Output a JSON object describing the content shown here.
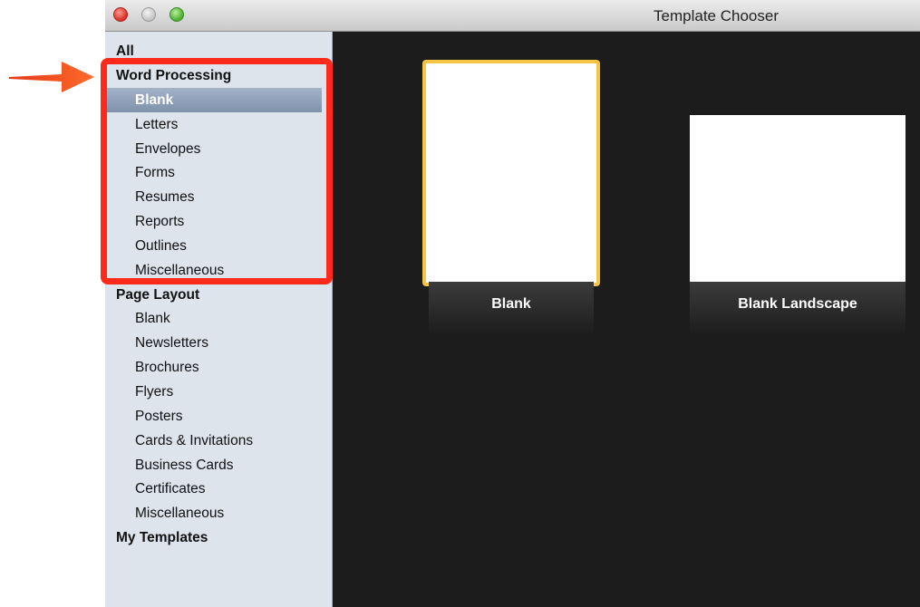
{
  "window": {
    "title": "Template Chooser"
  },
  "sidebar": {
    "all": "All",
    "word_processing": {
      "label": "Word Processing",
      "items": [
        "Blank",
        "Letters",
        "Envelopes",
        "Forms",
        "Resumes",
        "Reports",
        "Outlines",
        "Miscellaneous"
      ]
    },
    "page_layout": {
      "label": "Page Layout",
      "items": [
        "Blank",
        "Newsletters",
        "Brochures",
        "Flyers",
        "Posters",
        "Cards & Invitations",
        "Business Cards",
        "Certificates",
        "Miscellaneous"
      ]
    },
    "my_templates": "My Templates",
    "selected": "Blank"
  },
  "templates": [
    {
      "label": "Blank",
      "selected": true
    },
    {
      "label": "Blank Landscape",
      "selected": false
    }
  ],
  "annotation": {
    "highlight_color": "#ff2a1a",
    "arrow_color": "#f04a1e"
  }
}
